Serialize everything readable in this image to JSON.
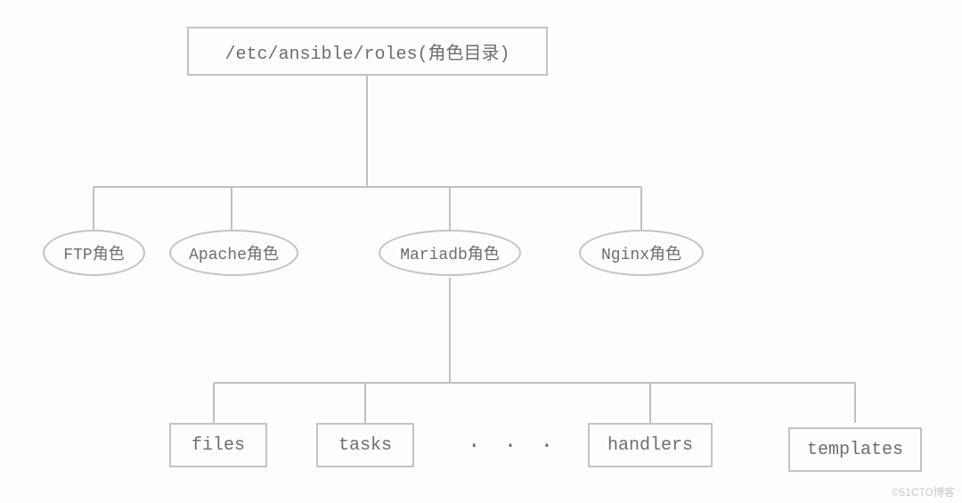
{
  "diagram": {
    "root": "/etc/ansible/roles(角色目录)",
    "roles": [
      "FTP角色",
      "Apache角色",
      "Mariadb角色",
      "Nginx角色"
    ],
    "subdirs": [
      "files",
      "tasks",
      "handlers",
      "templates"
    ],
    "ellipsis": "· · ·"
  },
  "watermark": "©51CTO博客"
}
